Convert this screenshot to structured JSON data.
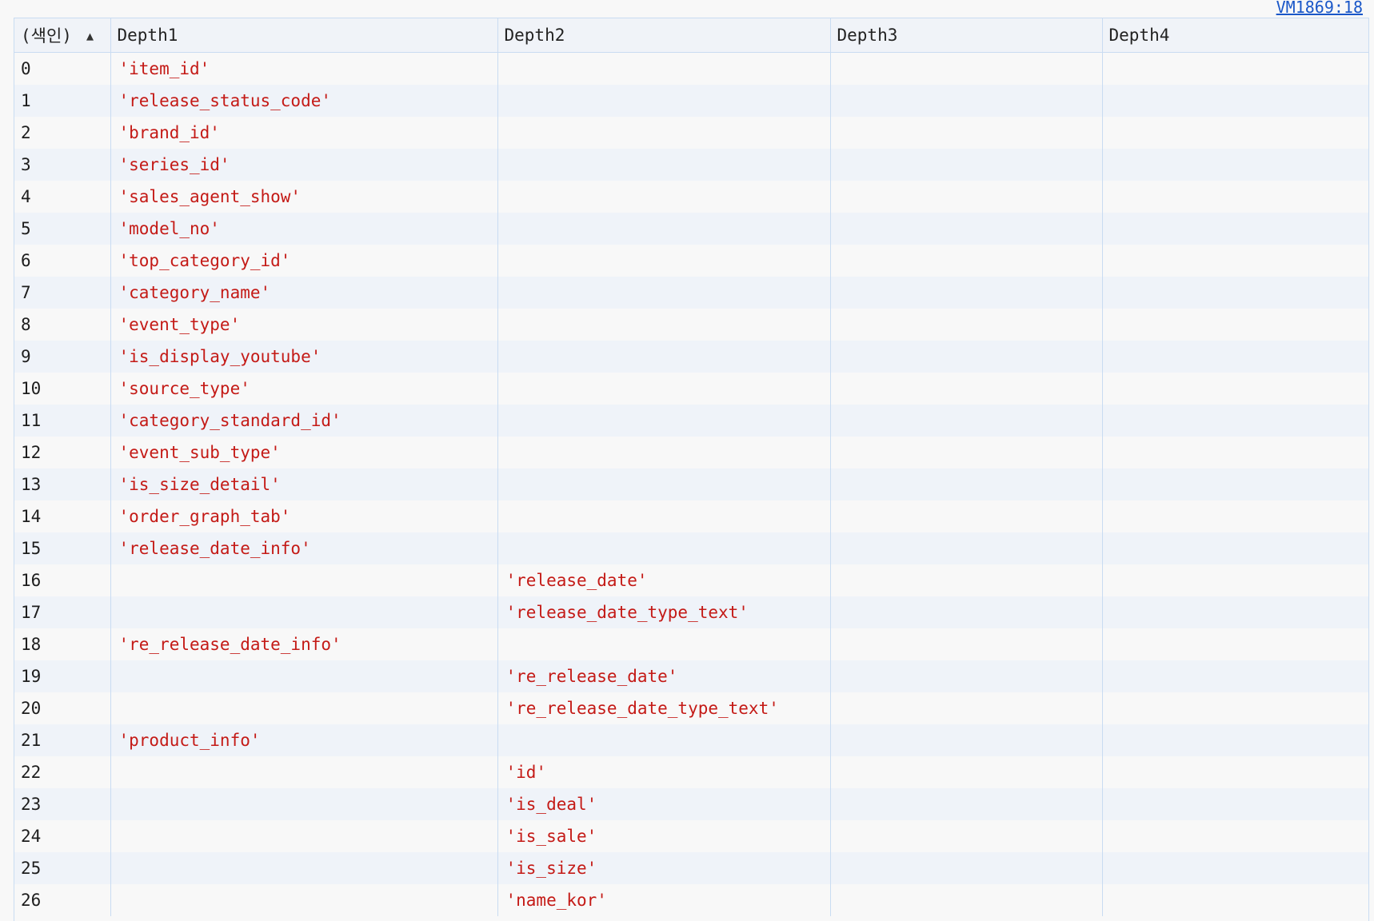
{
  "source_link": "VM1869:18",
  "table": {
    "columns": [
      {
        "label": "(색인)",
        "sort_icon": "▲"
      },
      {
        "label": "Depth1"
      },
      {
        "label": "Depth2"
      },
      {
        "label": "Depth3"
      },
      {
        "label": "Depth4"
      }
    ],
    "rows": [
      {
        "index": "0",
        "d1": "'item_id'",
        "d2": "",
        "d3": "",
        "d4": ""
      },
      {
        "index": "1",
        "d1": "'release_status_code'",
        "d2": "",
        "d3": "",
        "d4": ""
      },
      {
        "index": "2",
        "d1": "'brand_id'",
        "d2": "",
        "d3": "",
        "d4": ""
      },
      {
        "index": "3",
        "d1": "'series_id'",
        "d2": "",
        "d3": "",
        "d4": ""
      },
      {
        "index": "4",
        "d1": "'sales_agent_show'",
        "d2": "",
        "d3": "",
        "d4": ""
      },
      {
        "index": "5",
        "d1": "'model_no'",
        "d2": "",
        "d3": "",
        "d4": ""
      },
      {
        "index": "6",
        "d1": "'top_category_id'",
        "d2": "",
        "d3": "",
        "d4": ""
      },
      {
        "index": "7",
        "d1": "'category_name'",
        "d2": "",
        "d3": "",
        "d4": ""
      },
      {
        "index": "8",
        "d1": "'event_type'",
        "d2": "",
        "d3": "",
        "d4": ""
      },
      {
        "index": "9",
        "d1": "'is_display_youtube'",
        "d2": "",
        "d3": "",
        "d4": ""
      },
      {
        "index": "10",
        "d1": "'source_type'",
        "d2": "",
        "d3": "",
        "d4": ""
      },
      {
        "index": "11",
        "d1": "'category_standard_id'",
        "d2": "",
        "d3": "",
        "d4": ""
      },
      {
        "index": "12",
        "d1": "'event_sub_type'",
        "d2": "",
        "d3": "",
        "d4": ""
      },
      {
        "index": "13",
        "d1": "'is_size_detail'",
        "d2": "",
        "d3": "",
        "d4": ""
      },
      {
        "index": "14",
        "d1": "'order_graph_tab'",
        "d2": "",
        "d3": "",
        "d4": ""
      },
      {
        "index": "15",
        "d1": "'release_date_info'",
        "d2": "",
        "d3": "",
        "d4": ""
      },
      {
        "index": "16",
        "d1": "",
        "d2": "'release_date'",
        "d3": "",
        "d4": ""
      },
      {
        "index": "17",
        "d1": "",
        "d2": "'release_date_type_text'",
        "d3": "",
        "d4": ""
      },
      {
        "index": "18",
        "d1": "'re_release_date_info'",
        "d2": "",
        "d3": "",
        "d4": ""
      },
      {
        "index": "19",
        "d1": "",
        "d2": "'re_release_date'",
        "d3": "",
        "d4": ""
      },
      {
        "index": "20",
        "d1": "",
        "d2": "'re_release_date_type_text'",
        "d3": "",
        "d4": ""
      },
      {
        "index": "21",
        "d1": "'product_info'",
        "d2": "",
        "d3": "",
        "d4": ""
      },
      {
        "index": "22",
        "d1": "",
        "d2": "'id'",
        "d3": "",
        "d4": ""
      },
      {
        "index": "23",
        "d1": "",
        "d2": "'is_deal'",
        "d3": "",
        "d4": ""
      },
      {
        "index": "24",
        "d1": "",
        "d2": "'is_sale'",
        "d3": "",
        "d4": ""
      },
      {
        "index": "25",
        "d1": "",
        "d2": "'is_size'",
        "d3": "",
        "d4": ""
      },
      {
        "index": "26",
        "d1": "",
        "d2": "'name_kor'",
        "d3": "",
        "d4": ""
      }
    ]
  }
}
